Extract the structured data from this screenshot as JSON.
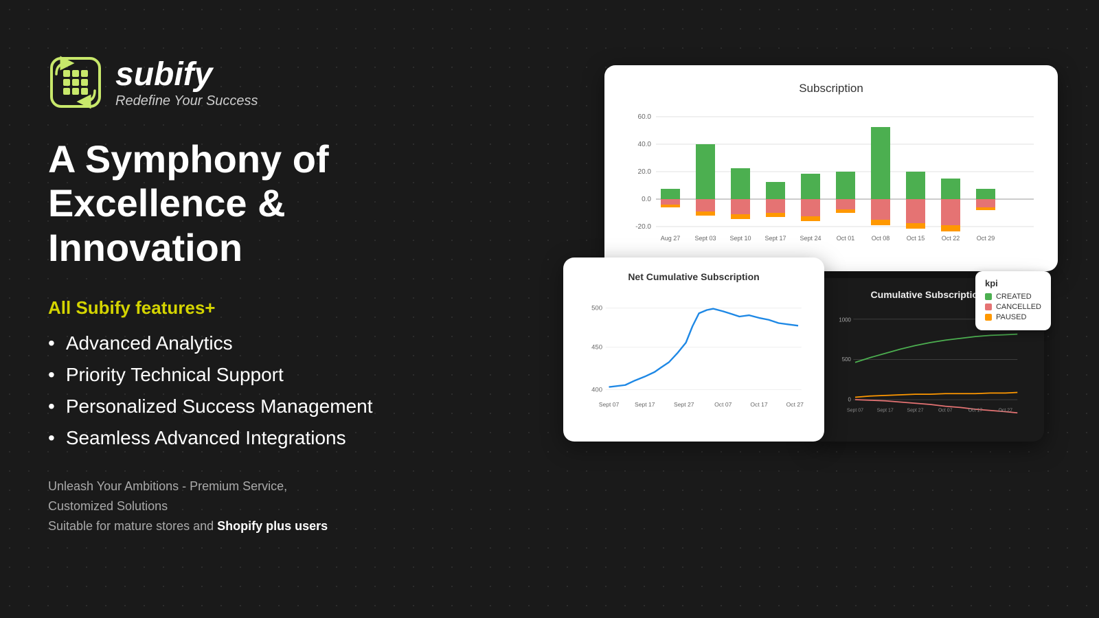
{
  "logo": {
    "title": "subify",
    "subtitle": "Redefine Your Success"
  },
  "headline": {
    "line1": "A Symphony of",
    "line2": "Excellence & Innovation"
  },
  "features": {
    "label": "All Subify features+",
    "items": [
      "Advanced Analytics",
      "Priority Technical Support",
      "Personalized Success Management",
      "Seamless Advanced Integrations"
    ]
  },
  "footer": {
    "line1": "Unleash Your Ambitions - Premium Service,",
    "line2": "Customized Solutions",
    "line3": "Suitable for mature stores and ",
    "highlight": "Shopify plus users"
  },
  "mainChart": {
    "title": "Subscription",
    "xLabels": [
      "Aug 27",
      "Sept 03",
      "Sept 10",
      "Sept 17",
      "Sept 24",
      "Oct 01",
      "Oct 08",
      "Oct 15",
      "Oct 22",
      "Oct 29"
    ],
    "yLabels": [
      "60.0",
      "40.0",
      "20.0",
      "0.0",
      "-20.0"
    ]
  },
  "kpiLegend": {
    "title": "kpi",
    "items": [
      {
        "label": "CREATED",
        "color": "#4caf50"
      },
      {
        "label": "CANCELLED",
        "color": "#e57373"
      },
      {
        "label": "PAUSED",
        "color": "#ff9800"
      }
    ]
  },
  "netCumulativeChart": {
    "title": "Net Cumulative Subscription",
    "yLabels": [
      "500",
      "450",
      "400"
    ],
    "xLabels": [
      "Sept 07",
      "Sept 17",
      "Sept 27",
      "Oct 07",
      "Oct 17",
      "Oct 27"
    ]
  },
  "cumulativeChart": {
    "title": "Cumulative Subscription",
    "yLabels": [
      "1000",
      "500",
      "0"
    ],
    "xLabels": [
      "Sept 07",
      "Sept 17",
      "Sept 27",
      "Oct 07",
      "Oct 17",
      "Oct 27"
    ]
  }
}
